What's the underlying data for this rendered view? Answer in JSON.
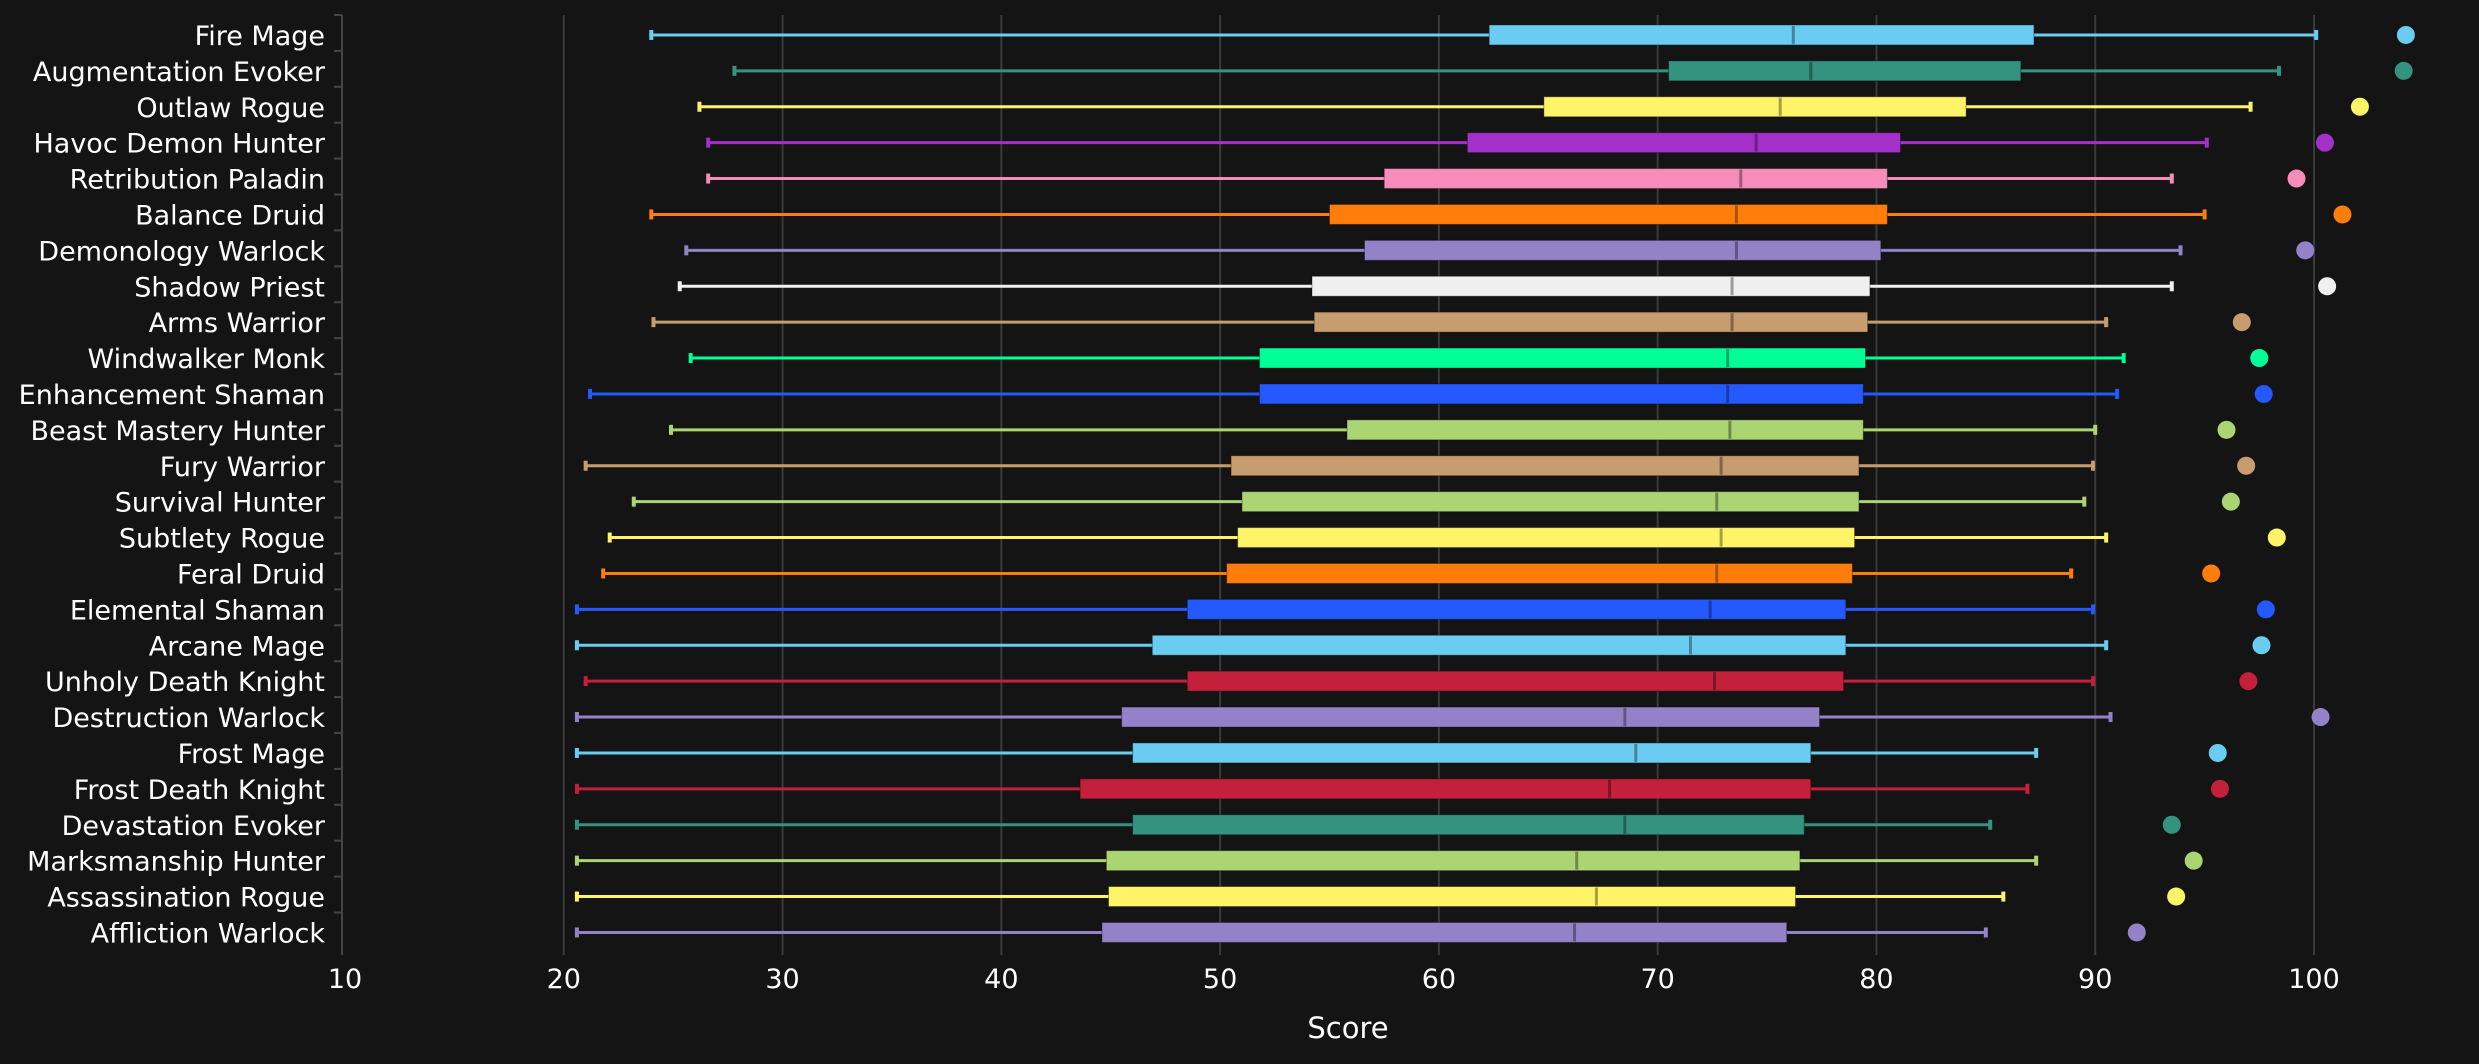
{
  "chart_data": {
    "type": "box",
    "title": "",
    "xlabel": "Score",
    "ylabel": "",
    "xlim": [
      10,
      105
    ],
    "xticks": [
      10,
      20,
      30,
      40,
      50,
      60,
      70,
      80,
      90,
      100
    ],
    "grid": true,
    "legend": "none",
    "series": [
      {
        "name": "Fire Mage",
        "color": "#69CCF0",
        "min": 24.0,
        "q1": 62.3,
        "median": 76.2,
        "q3": 87.2,
        "max": 100.1,
        "dot": 104.2
      },
      {
        "name": "Augmentation Evoker",
        "color": "#33937F",
        "min": 27.8,
        "q1": 70.5,
        "median": 77.0,
        "q3": 86.6,
        "max": 98.4,
        "dot": 104.1
      },
      {
        "name": "Outlaw Rogue",
        "color": "#FFF468",
        "min": 26.2,
        "q1": 64.8,
        "median": 75.6,
        "q3": 84.1,
        "max": 97.1,
        "dot": 102.1
      },
      {
        "name": "Havoc Demon Hunter",
        "color": "#A330C9",
        "min": 26.6,
        "q1": 61.3,
        "median": 74.5,
        "q3": 81.1,
        "max": 95.1,
        "dot": 100.5
      },
      {
        "name": "Retribution Paladin",
        "color": "#F58CBA",
        "min": 26.6,
        "q1": 57.5,
        "median": 73.8,
        "q3": 80.5,
        "max": 93.5,
        "dot": 99.2
      },
      {
        "name": "Balance Druid",
        "color": "#FF7D0A",
        "min": 24.0,
        "q1": 55.0,
        "median": 73.6,
        "q3": 80.5,
        "max": 95.0,
        "dot": 101.3
      },
      {
        "name": "Demonology Warlock",
        "color": "#9482C9",
        "min": 25.6,
        "q1": 56.6,
        "median": 73.6,
        "q3": 80.2,
        "max": 93.9,
        "dot": 99.6
      },
      {
        "name": "Shadow Priest",
        "color": "#F0F0F0",
        "min": 25.3,
        "q1": 54.2,
        "median": 73.4,
        "q3": 79.7,
        "max": 93.5,
        "dot": 100.6
      },
      {
        "name": "Arms Warrior",
        "color": "#C79C6E",
        "min": 24.1,
        "q1": 54.3,
        "median": 73.4,
        "q3": 79.6,
        "max": 90.5,
        "dot": 96.7
      },
      {
        "name": "Windwalker Monk",
        "color": "#00FF96",
        "min": 25.8,
        "q1": 51.8,
        "median": 73.2,
        "q3": 79.5,
        "max": 91.3,
        "dot": 97.5
      },
      {
        "name": "Enhancement Shaman",
        "color": "#2459FF",
        "min": 21.2,
        "q1": 51.8,
        "median": 73.2,
        "q3": 79.4,
        "max": 91.0,
        "dot": 97.7
      },
      {
        "name": "Beast Mastery Hunter",
        "color": "#ABD473",
        "min": 24.9,
        "q1": 55.8,
        "median": 73.3,
        "q3": 79.4,
        "max": 90.0,
        "dot": 96.0
      },
      {
        "name": "Fury Warrior",
        "color": "#C79C6E",
        "min": 21.0,
        "q1": 50.5,
        "median": 72.9,
        "q3": 79.2,
        "max": 89.9,
        "dot": 96.9
      },
      {
        "name": "Survival Hunter",
        "color": "#ABD473",
        "min": 23.2,
        "q1": 51.0,
        "median": 72.7,
        "q3": 79.2,
        "max": 89.5,
        "dot": 96.2
      },
      {
        "name": "Subtlety Rogue",
        "color": "#FFF468",
        "min": 22.1,
        "q1": 50.8,
        "median": 72.9,
        "q3": 79.0,
        "max": 90.5,
        "dot": 98.3
      },
      {
        "name": "Feral Druid",
        "color": "#FF7D0A",
        "min": 21.8,
        "q1": 50.3,
        "median": 72.7,
        "q3": 78.9,
        "max": 88.9,
        "dot": 95.3
      },
      {
        "name": "Elemental Shaman",
        "color": "#2459FF",
        "min": 20.6,
        "q1": 48.5,
        "median": 72.4,
        "q3": 78.6,
        "max": 89.9,
        "dot": 97.8
      },
      {
        "name": "Arcane Mage",
        "color": "#69CCF0",
        "min": 20.6,
        "q1": 46.9,
        "median": 71.5,
        "q3": 78.6,
        "max": 90.5,
        "dot": 97.6
      },
      {
        "name": "Unholy Death Knight",
        "color": "#C41F3B",
        "min": 21.0,
        "q1": 48.5,
        "median": 72.6,
        "q3": 78.5,
        "max": 89.9,
        "dot": 97.0
      },
      {
        "name": "Destruction Warlock",
        "color": "#9482C9",
        "min": 20.6,
        "q1": 45.5,
        "median": 68.5,
        "q3": 77.4,
        "max": 90.7,
        "dot": 100.3
      },
      {
        "name": "Frost Mage",
        "color": "#69CCF0",
        "min": 20.6,
        "q1": 46.0,
        "median": 69.0,
        "q3": 77.0,
        "max": 87.3,
        "dot": 95.6
      },
      {
        "name": "Frost Death Knight",
        "color": "#C41F3B",
        "min": 20.6,
        "q1": 43.6,
        "median": 67.8,
        "q3": 77.0,
        "max": 86.9,
        "dot": 95.7
      },
      {
        "name": "Devastation Evoker",
        "color": "#33937F",
        "min": 20.6,
        "q1": 46.0,
        "median": 68.5,
        "q3": 76.7,
        "max": 85.2,
        "dot": 93.5
      },
      {
        "name": "Marksmanship Hunter",
        "color": "#ABD473",
        "min": 20.6,
        "q1": 44.8,
        "median": 66.3,
        "q3": 76.5,
        "max": 87.3,
        "dot": 94.5
      },
      {
        "name": "Assassination Rogue",
        "color": "#FFF468",
        "min": 20.6,
        "q1": 44.9,
        "median": 67.2,
        "q3": 76.3,
        "max": 85.8,
        "dot": 93.7
      },
      {
        "name": "Affliction Warlock",
        "color": "#9482C9",
        "min": 20.6,
        "q1": 44.6,
        "median": 66.2,
        "q3": 75.9,
        "max": 85.0,
        "dot": 91.9
      }
    ]
  }
}
